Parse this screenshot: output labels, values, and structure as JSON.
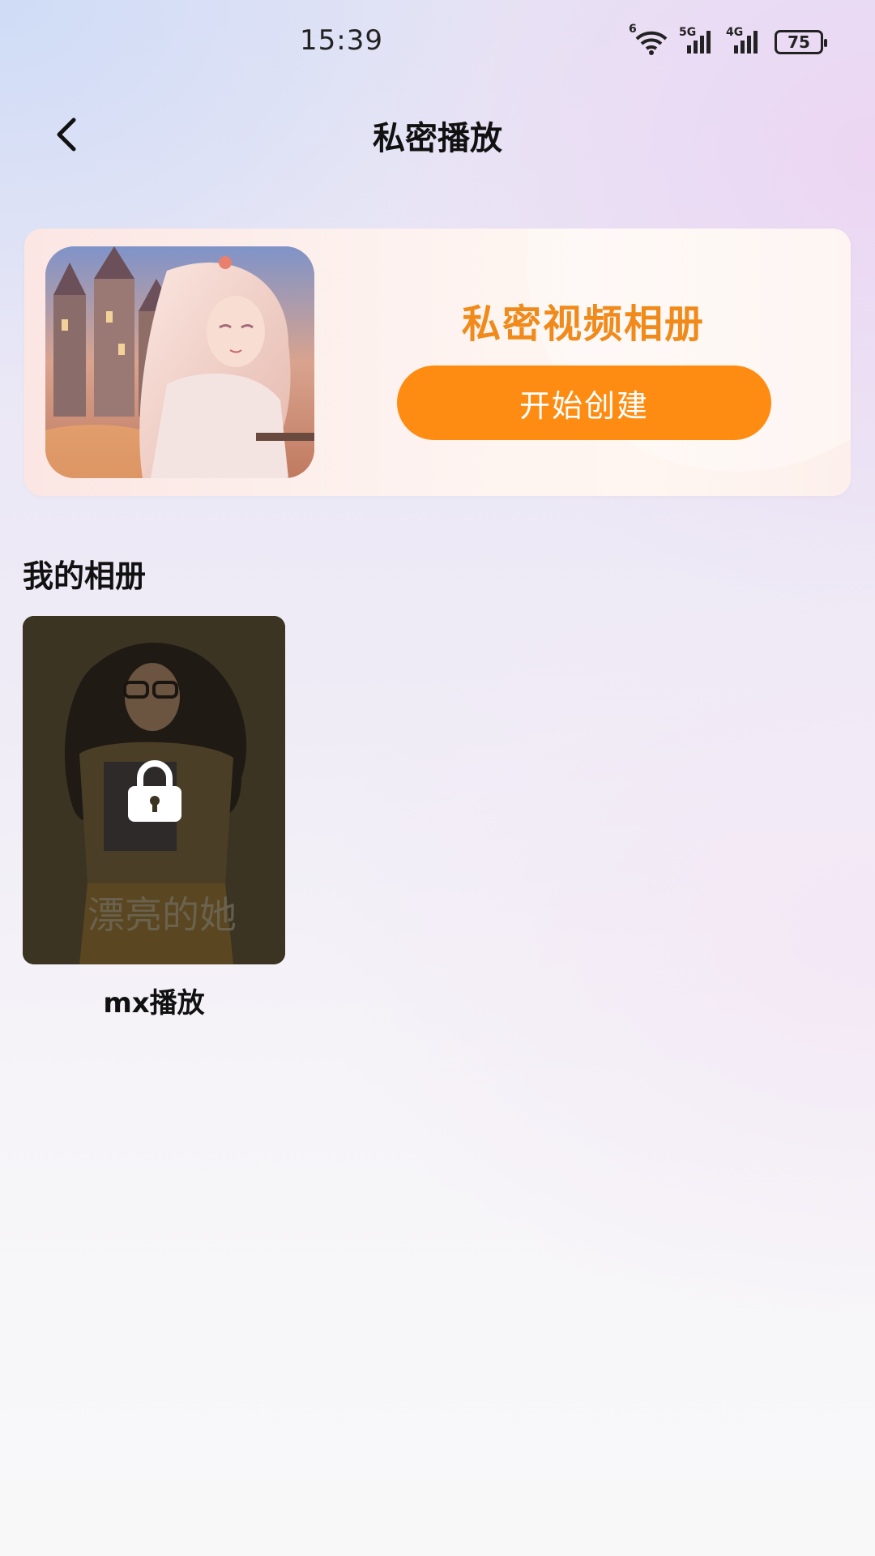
{
  "status_bar": {
    "time": "15:39",
    "wifi_tag": "6",
    "sim1_tag": "5G",
    "sim2_tag": "4G",
    "battery": "75"
  },
  "header": {
    "title": "私密播放",
    "back_icon": "chevron-left-icon"
  },
  "banner": {
    "title": "私密视频相册",
    "button_label": "开始创建",
    "accent_color": "#fe8c12",
    "title_color": "#f08a1a"
  },
  "albums": {
    "section_title": "我的相册",
    "items": [
      {
        "name": "mx播放",
        "locked": true,
        "lock_icon": "lock-icon"
      }
    ]
  }
}
